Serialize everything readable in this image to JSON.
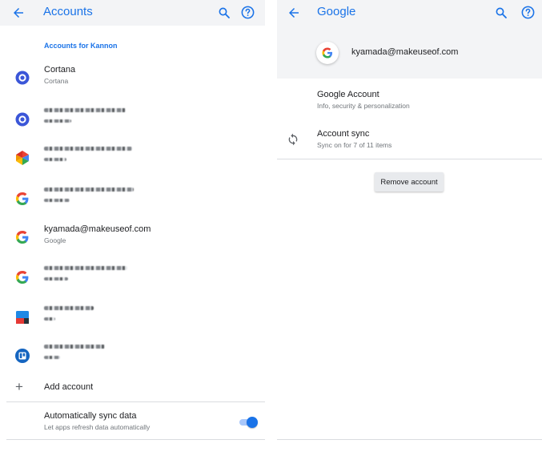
{
  "left": {
    "title": "Accounts",
    "section_header": "Accounts for Kannon",
    "accounts": [
      {
        "icon": "cortana-icon",
        "name": "Cortana",
        "sub": "Cortana",
        "redacted": false
      },
      {
        "icon": "cortana-icon",
        "name": "",
        "sub": "",
        "redacted": true
      },
      {
        "icon": "multicolor-app-icon",
        "name": "",
        "sub": "",
        "redacted": true
      },
      {
        "icon": "google-icon",
        "name": "",
        "sub": "",
        "redacted": true
      },
      {
        "icon": "google-icon",
        "name": "kyamada@makeuseof.com",
        "sub": "Google",
        "redacted": false
      },
      {
        "icon": "google-icon",
        "name": "",
        "sub": "",
        "redacted": true
      },
      {
        "icon": "blue-square-app-icon",
        "name": "",
        "sub": "",
        "redacted": true
      },
      {
        "icon": "trello-icon",
        "name": "",
        "sub": "",
        "redacted": true
      }
    ],
    "add_account": "Add account",
    "sync": {
      "label": "Automatically sync data",
      "sub": "Let apps refresh data automatically",
      "enabled": true
    }
  },
  "right": {
    "title": "Google",
    "email": "kyamada@makeuseof.com",
    "google_account": {
      "label": "Google Account",
      "sub": "Info, security & personalization"
    },
    "account_sync": {
      "label": "Account sync",
      "sub": "Sync on for 7 of 11 items"
    },
    "remove_button": "Remove account"
  },
  "colors": {
    "accent": "#1a73e8",
    "header_bg": "#f3f4f6",
    "cortana": "#3b56d8",
    "google_blue": "#4285f4",
    "google_red": "#ea4335",
    "google_yellow": "#fbbc05",
    "google_green": "#34a853"
  }
}
